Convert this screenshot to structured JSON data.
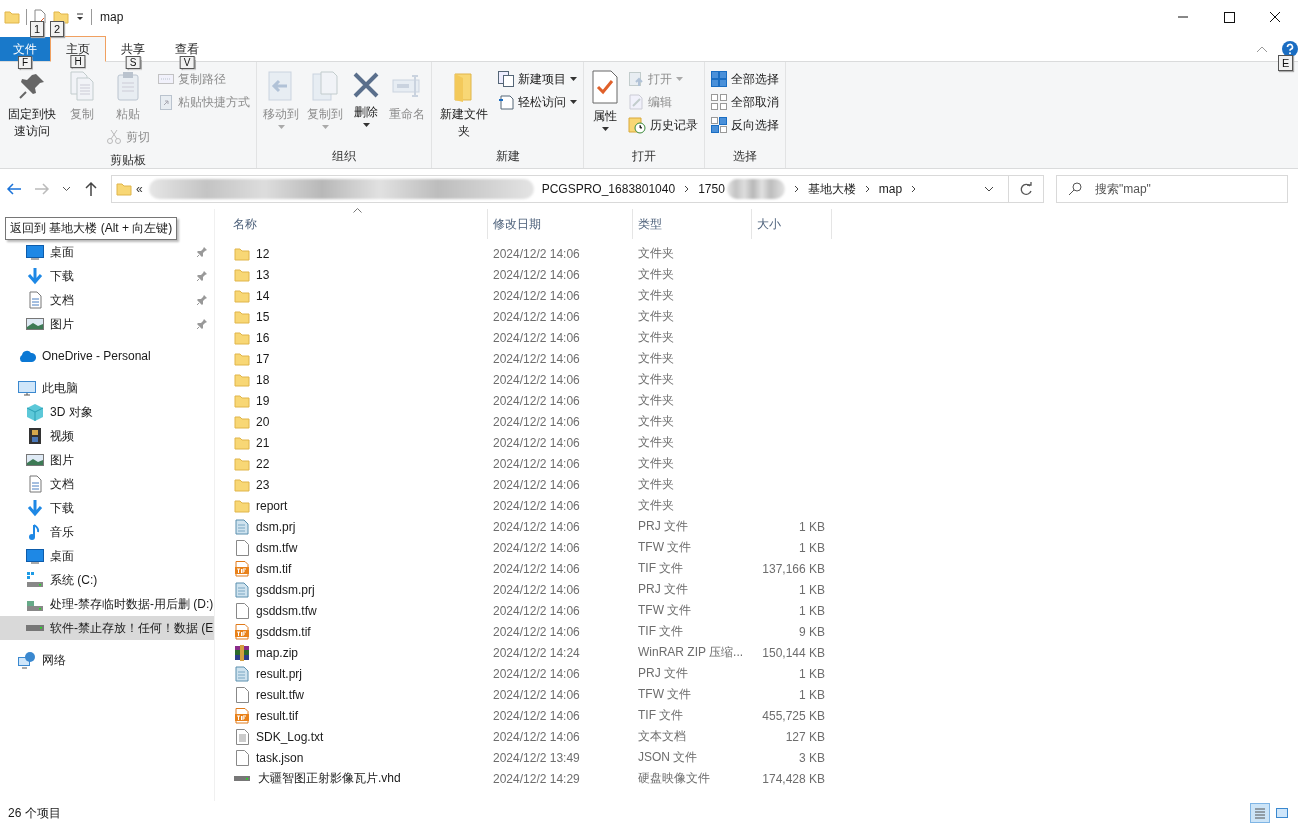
{
  "window": {
    "title": "map"
  },
  "keytips": {
    "quick_access": [
      "1",
      "2"
    ],
    "tabs": [
      "F",
      "H",
      "S",
      "V"
    ],
    "help": "E"
  },
  "tabs": [
    {
      "label": "文件",
      "kind": "file",
      "selected": false
    },
    {
      "label": "主页",
      "kind": "tab",
      "selected": true
    },
    {
      "label": "共享",
      "kind": "tab",
      "selected": false
    },
    {
      "label": "查看",
      "kind": "tab",
      "selected": false
    }
  ],
  "ribbon": [
    {
      "label": "剪贴板",
      "columns": [
        [
          {
            "label": "固定到快速访问",
            "kind": "large",
            "disabled": false,
            "dropdown": false
          }
        ],
        [
          {
            "label": "复制",
            "kind": "large",
            "disabled": true,
            "dropdown": false
          }
        ],
        [
          {
            "label": "粘贴",
            "kind": "large",
            "disabled": true,
            "dropdown": false
          },
          {
            "label": "剪切",
            "kind": "small",
            "disabled": true,
            "dropdown": false
          }
        ],
        [
          {
            "label": "复制路径",
            "kind": "small",
            "disabled": true,
            "dropdown": false
          },
          {
            "label": "粘贴快捷方式",
            "kind": "small",
            "disabled": true,
            "dropdown": false
          }
        ]
      ]
    },
    {
      "label": "组织",
      "columns": [
        [
          {
            "label": "移动到",
            "kind": "large",
            "disabled": true,
            "dropdown": true
          }
        ],
        [
          {
            "label": "复制到",
            "kind": "large",
            "disabled": true,
            "dropdown": true
          }
        ],
        [
          {
            "label": "删除",
            "kind": "large",
            "disabled": false,
            "dropdown": true
          }
        ],
        [
          {
            "label": "重命名",
            "kind": "large",
            "disabled": true,
            "dropdown": false
          }
        ]
      ]
    },
    {
      "label": "新建",
      "columns": [
        [
          {
            "label": "新建文件夹",
            "kind": "large",
            "disabled": false,
            "dropdown": false
          }
        ],
        [
          {
            "label": "新建项目",
            "kind": "small",
            "disabled": false,
            "dropdown": true
          },
          {
            "label": "轻松访问",
            "kind": "small",
            "disabled": false,
            "dropdown": true
          }
        ]
      ]
    },
    {
      "label": "打开",
      "columns": [
        [
          {
            "label": "属性",
            "kind": "large",
            "disabled": false,
            "dropdown": true
          }
        ],
        [
          {
            "label": "打开",
            "kind": "small",
            "disabled": true,
            "dropdown": true
          },
          {
            "label": "编辑",
            "kind": "small",
            "disabled": true,
            "dropdown": false
          },
          {
            "label": "历史记录",
            "kind": "small",
            "disabled": false,
            "dropdown": false
          }
        ]
      ]
    },
    {
      "label": "选择",
      "columns": [
        [
          {
            "label": "全部选择",
            "kind": "small",
            "disabled": false,
            "dropdown": false
          },
          {
            "label": "全部取消",
            "kind": "small",
            "disabled": false,
            "dropdown": false
          },
          {
            "label": "反向选择",
            "kind": "small",
            "disabled": false,
            "dropdown": false
          }
        ]
      ]
    }
  ],
  "address": {
    "overflow": "«",
    "segments": [
      {
        "redacted": true
      },
      {
        "label": "PCGSPRO_1683801040",
        "redacted": false
      },
      {
        "label": "1750",
        "redacted": true
      },
      {
        "label": "基地大楼",
        "redacted": false
      },
      {
        "label": "map",
        "redacted": false
      }
    ]
  },
  "search": {
    "placeholder": "搜索\"map\""
  },
  "tooltip": "返回到 基地大楼 (Alt + 向左键)",
  "nav": [
    {
      "children": [
        {
          "label": "桌面",
          "kind": "desktop",
          "pinned": true,
          "selected": false
        },
        {
          "label": "下载",
          "kind": "downloads",
          "pinned": true,
          "selected": false
        },
        {
          "label": "文档",
          "kind": "documents",
          "pinned": true,
          "selected": false
        },
        {
          "label": "图片",
          "kind": "pictures",
          "pinned": true,
          "selected": false
        }
      ]
    },
    {
      "label": "OneDrive - Personal",
      "kind": "cloud",
      "selected": false
    },
    {
      "label": "此电脑",
      "kind": "computer",
      "selected": false,
      "children": [
        {
          "label": "3D 对象",
          "kind": "objects3d",
          "selected": false
        },
        {
          "label": "视频",
          "kind": "videos",
          "selected": false
        },
        {
          "label": "图片",
          "kind": "pictures",
          "selected": false
        },
        {
          "label": "文档",
          "kind": "documents",
          "selected": false
        },
        {
          "label": "下载",
          "kind": "downloads",
          "selected": false
        },
        {
          "label": "音乐",
          "kind": "music",
          "selected": false
        },
        {
          "label": "桌面",
          "kind": "desktop",
          "selected": false
        },
        {
          "label": "系统 (C:)",
          "kind": "systemdrive",
          "selected": false
        },
        {
          "label": "处理-禁存临时数据-用后删 (D:)",
          "kind": "netdrive",
          "selected": false
        },
        {
          "label": "软件-禁止存放！任何！数据 (E",
          "kind": "drive",
          "selected": true
        }
      ]
    },
    {
      "label": "网络",
      "kind": "network",
      "selected": false
    }
  ],
  "columns": [
    "名称",
    "修改日期",
    "类型",
    "大小"
  ],
  "files": [
    {
      "name": "12",
      "date": "2024/12/2 14:06",
      "type": "文件夹",
      "kind": "folder"
    },
    {
      "name": "13",
      "date": "2024/12/2 14:06",
      "type": "文件夹",
      "kind": "folder"
    },
    {
      "name": "14",
      "date": "2024/12/2 14:06",
      "type": "文件夹",
      "kind": "folder"
    },
    {
      "name": "15",
      "date": "2024/12/2 14:06",
      "type": "文件夹",
      "kind": "folder"
    },
    {
      "name": "16",
      "date": "2024/12/2 14:06",
      "type": "文件夹",
      "kind": "folder"
    },
    {
      "name": "17",
      "date": "2024/12/2 14:06",
      "type": "文件夹",
      "kind": "folder"
    },
    {
      "name": "18",
      "date": "2024/12/2 14:06",
      "type": "文件夹",
      "kind": "folder"
    },
    {
      "name": "19",
      "date": "2024/12/2 14:06",
      "type": "文件夹",
      "kind": "folder"
    },
    {
      "name": "20",
      "date": "2024/12/2 14:06",
      "type": "文件夹",
      "kind": "folder"
    },
    {
      "name": "21",
      "date": "2024/12/2 14:06",
      "type": "文件夹",
      "kind": "folder"
    },
    {
      "name": "22",
      "date": "2024/12/2 14:06",
      "type": "文件夹",
      "kind": "folder"
    },
    {
      "name": "23",
      "date": "2024/12/2 14:06",
      "type": "文件夹",
      "kind": "folder"
    },
    {
      "name": "report",
      "date": "2024/12/2 14:06",
      "type": "文件夹",
      "kind": "folder"
    },
    {
      "name": "dsm.prj",
      "date": "2024/12/2 14:06",
      "type": "PRJ 文件",
      "size": "1 KB",
      "kind": "prj"
    },
    {
      "name": "dsm.tfw",
      "date": "2024/12/2 14:06",
      "type": "TFW 文件",
      "size": "1 KB",
      "kind": "blank"
    },
    {
      "name": "dsm.tif",
      "date": "2024/12/2 14:06",
      "type": "TIF 文件",
      "size": "137,166 KB",
      "kind": "tif"
    },
    {
      "name": "gsddsm.prj",
      "date": "2024/12/2 14:06",
      "type": "PRJ 文件",
      "size": "1 KB",
      "kind": "prj"
    },
    {
      "name": "gsddsm.tfw",
      "date": "2024/12/2 14:06",
      "type": "TFW 文件",
      "size": "1 KB",
      "kind": "blank"
    },
    {
      "name": "gsddsm.tif",
      "date": "2024/12/2 14:06",
      "type": "TIF 文件",
      "size": "9 KB",
      "kind": "tif"
    },
    {
      "name": "map.zip",
      "date": "2024/12/2 14:24",
      "type": "WinRAR ZIP 压缩...",
      "size": "150,144 KB",
      "kind": "zip"
    },
    {
      "name": "result.prj",
      "date": "2024/12/2 14:06",
      "type": "PRJ 文件",
      "size": "1 KB",
      "kind": "prj"
    },
    {
      "name": "result.tfw",
      "date": "2024/12/2 14:06",
      "type": "TFW 文件",
      "size": "1 KB",
      "kind": "blank"
    },
    {
      "name": "result.tif",
      "date": "2024/12/2 14:06",
      "type": "TIF 文件",
      "size": "455,725 KB",
      "kind": "tif"
    },
    {
      "name": "SDK_Log.txt",
      "date": "2024/12/2 14:06",
      "type": "文本文档",
      "size": "127 KB",
      "kind": "text"
    },
    {
      "name": "task.json",
      "date": "2024/12/2 13:49",
      "type": "JSON 文件",
      "size": "3 KB",
      "kind": "blank"
    },
    {
      "name": "大疆智图正射影像瓦片.vhd",
      "date": "2024/12/2 14:29",
      "type": "硬盘映像文件",
      "size": "174,428 KB",
      "kind": "vhd"
    }
  ],
  "status_bar": {
    "count": "26 个项目",
    "views": [
      {
        "kind": "details",
        "selected": true
      },
      {
        "kind": "large",
        "selected": false
      }
    ]
  }
}
